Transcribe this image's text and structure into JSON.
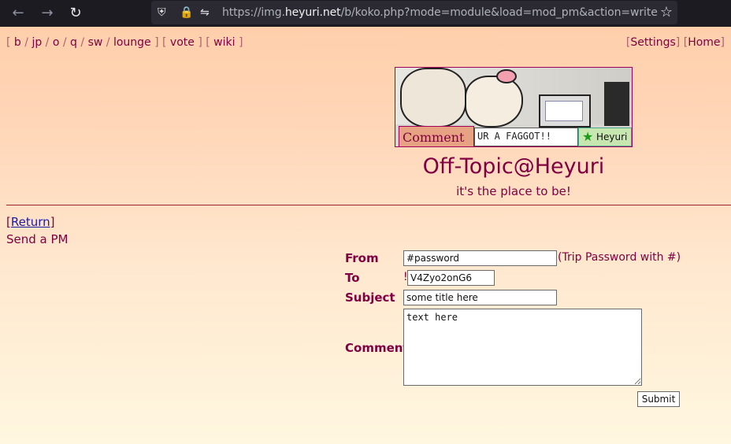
{
  "browser": {
    "url_prefix": "https://img.",
    "url_domain": "heyuri.net",
    "url_rest": "/b/koko.php?mode=module&load=mod_pm&action=write"
  },
  "boardnav": {
    "links": [
      "b",
      "jp",
      "o",
      "q",
      "sw",
      "lounge",
      "vote",
      "wiki"
    ]
  },
  "topright": {
    "settings": "Settings",
    "home": "Home"
  },
  "banner": {
    "comment_label": "Comment",
    "input_text": "UR A FAGGOT!!",
    "button_label": "Heyuri"
  },
  "header": {
    "title": "Off-Topic@Heyuri",
    "subtitle": "it's the place to be!"
  },
  "page": {
    "return_label": "Return",
    "send_pm": "Send a PM"
  },
  "form": {
    "from_label": "From",
    "from_value": "#password",
    "from_hint": "(Trip Password with #)",
    "to_label": "To",
    "to_prefix": "!",
    "to_value": "V4Zyo2onG6",
    "subject_label": "Subject",
    "subject_value": "some title here",
    "comment_label": "Comment",
    "comment_value": "text here",
    "submit_label": "Submit"
  }
}
